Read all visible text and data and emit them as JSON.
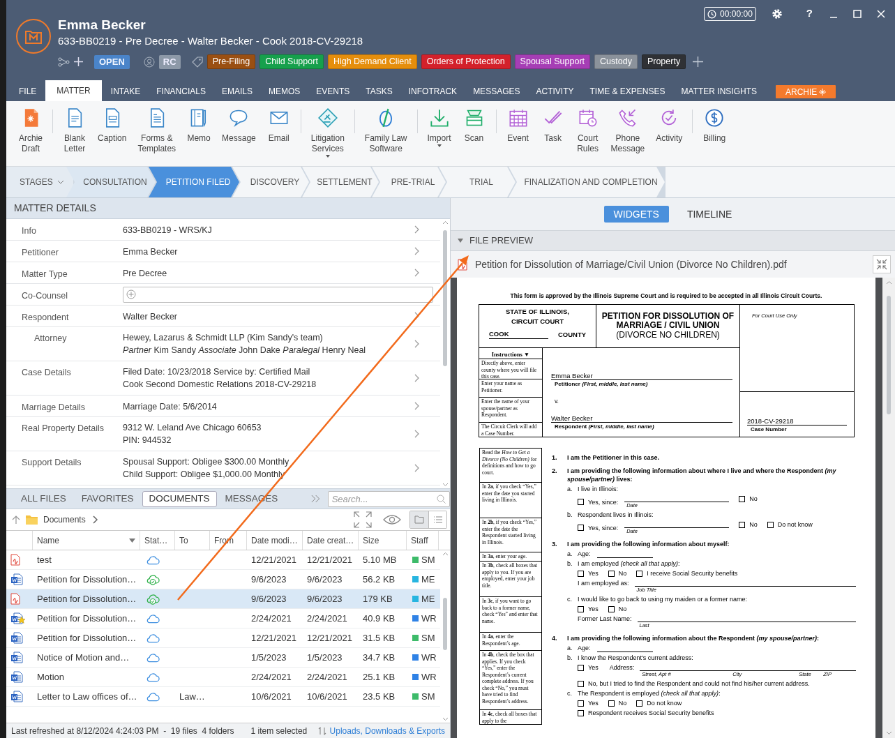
{
  "header": {
    "client_name": "Emma Becker",
    "matter_line": "633-BB0219 - Pre Decree - Walter Becker - Cook 2018-CV-29218",
    "status": "OPEN",
    "initials": "RC",
    "tags": [
      {
        "label": "Pre-Filing",
        "color": "#9a4f12"
      },
      {
        "label": "Child Support",
        "color": "#16a04c"
      },
      {
        "label": "High Demand Client",
        "color": "#e58e0c"
      },
      {
        "label": "Orders of Protection",
        "color": "#d3212b"
      },
      {
        "label": "Spousal Support",
        "color": "#a63eb5"
      },
      {
        "label": "Custody",
        "color": "#8b929b"
      },
      {
        "label": "Property",
        "color": "#2f3135"
      }
    ],
    "timer": "00:00:00",
    "help": "?"
  },
  "tabs": [
    {
      "label": "FILE",
      "selected": false
    },
    {
      "label": "MATTER",
      "selected": true
    },
    {
      "label": "INTAKE",
      "selected": false
    },
    {
      "label": "FINANCIALS",
      "selected": false
    },
    {
      "label": "EMAILS",
      "selected": false
    },
    {
      "label": "MEMOS",
      "selected": false
    },
    {
      "label": "EVENTS",
      "selected": false
    },
    {
      "label": "TASKS",
      "selected": false
    },
    {
      "label": "INFOTRACK",
      "selected": false
    },
    {
      "label": "MESSAGES",
      "selected": false
    },
    {
      "label": "ACTIVITY",
      "selected": false
    },
    {
      "label": "TIME & EXPENSES",
      "selected": false
    },
    {
      "label": "MATTER INSIGHTS",
      "selected": false
    }
  ],
  "archie_button": "ARCHIE",
  "ribbon": {
    "groups": [
      [
        {
          "label": "Archie\nDraft",
          "dropdown": false
        }
      ],
      [
        {
          "label": "Blank\nLetter",
          "dropdown": false
        },
        {
          "label": "Caption",
          "dropdown": false
        },
        {
          "label": "Forms &\nTemplates",
          "dropdown": false
        },
        {
          "label": "Memo",
          "dropdown": false
        },
        {
          "label": "Message",
          "dropdown": false
        },
        {
          "label": "Email",
          "dropdown": false
        }
      ],
      [
        {
          "label": "Litigation\nServices",
          "dropdown": true
        }
      ],
      [
        {
          "label": "Family Law\nSoftware",
          "dropdown": false
        }
      ],
      [
        {
          "label": "Import",
          "dropdown": true
        },
        {
          "label": "Scan",
          "dropdown": false
        }
      ],
      [
        {
          "label": "Event",
          "dropdown": false
        },
        {
          "label": "Task",
          "dropdown": false
        },
        {
          "label": "Court\nRules",
          "dropdown": false
        },
        {
          "label": "Phone\nMessage",
          "dropdown": false
        },
        {
          "label": "Activity",
          "dropdown": false
        }
      ],
      [
        {
          "label": "Billing",
          "dropdown": false
        }
      ]
    ]
  },
  "stages": {
    "label": "STAGES",
    "items": [
      {
        "label": "CONSULTATION",
        "selected": false,
        "completed": true
      },
      {
        "label": "PETITION FILED",
        "selected": true,
        "completed": false
      },
      {
        "label": "DISCOVERY",
        "selected": false,
        "completed": false
      },
      {
        "label": "SETTLEMENT",
        "selected": false,
        "completed": false
      },
      {
        "label": "PRE-TRIAL",
        "selected": false,
        "completed": false
      },
      {
        "label": "TRIAL",
        "selected": false,
        "completed": false
      },
      {
        "label": "FINALIZATION AND COMPLETION",
        "selected": false,
        "completed": false
      }
    ]
  },
  "matter_details": {
    "title": "MATTER DETAILS",
    "rows": [
      {
        "label": "Info",
        "kind": "text",
        "lines": [
          "633-BB0219 - WRS/KJ"
        ]
      },
      {
        "label": "Petitioner",
        "kind": "text",
        "lines": [
          "Emma Becker"
        ]
      },
      {
        "label": "Matter Type",
        "kind": "text",
        "lines": [
          "Pre Decree"
        ]
      },
      {
        "label": "Co-Counsel",
        "kind": "add_field"
      },
      {
        "label": "Respondent",
        "kind": "text",
        "lines": [
          "Walter Becker"
        ],
        "children": [
          {
            "label": "Attorney",
            "kind": "text",
            "lines": [
              "Hewey, Lazarus & Schmidt LLP (Kim Sandy's team)",
              "*Partner* Kim Sandy *Associate* John Dake *Paralegal* Henry Neal"
            ]
          }
        ]
      },
      {
        "label": "Case Details",
        "kind": "text",
        "lines": [
          "Filed Date: 10/23/2018 Service by: Certified Mail",
          "Cook Second Domestic Relations 2018-CV-29218"
        ]
      },
      {
        "label": "Marriage Details",
        "kind": "text",
        "lines": [
          "Marriage Date: 5/6/2014"
        ]
      },
      {
        "label": "Real Property Details",
        "kind": "text",
        "lines": [
          "9312 W. Leland Ave Chicago 60653",
          "PIN: 944532"
        ]
      },
      {
        "label": "Support Details",
        "kind": "text",
        "lines": [
          "Spousal Support: Obligee $300.00 Monthly",
          "Child Support: Obligee $1,000.00 Monthly"
        ]
      }
    ]
  },
  "files": {
    "tabs": [
      {
        "label": "ALL FILES",
        "selected": false
      },
      {
        "label": "FAVORITES",
        "selected": false
      },
      {
        "label": "DOCUMENTS",
        "selected": true
      },
      {
        "label": "MESSAGES",
        "selected": false
      }
    ],
    "search_placeholder": "Search...",
    "folder": "Documents",
    "view_modes": [
      {
        "kind": "folder",
        "selected": true
      },
      {
        "kind": "list",
        "selected": false
      }
    ],
    "columns": [
      {
        "label": "Name",
        "sorted": true
      },
      {
        "label": "Stat…"
      },
      {
        "label": "To"
      },
      {
        "label": "From"
      },
      {
        "label": "Date modi…"
      },
      {
        "label": "Date creat…"
      },
      {
        "label": "Size"
      },
      {
        "label": "Staff"
      }
    ],
    "rows": [
      {
        "kind": "pdf",
        "name": "test",
        "synced": false,
        "modified": "12/21/2021",
        "created": "12/21/2021",
        "size": "5.10 MB",
        "staff": {
          "initials": "SM",
          "color": "#3dbb6a"
        },
        "selected": false
      },
      {
        "kind": "word",
        "name": "Petition for Dissolution…",
        "synced": true,
        "modified": "9/6/2023",
        "created": "9/6/2023",
        "size": "56.2 KB",
        "staff": {
          "initials": "ME",
          "color": "#27b5e0"
        },
        "selected": false
      },
      {
        "kind": "pdf",
        "name": "Petition for Dissolution…",
        "synced": true,
        "modified": "9/6/2023",
        "created": "9/6/2023",
        "size": "179 KB",
        "staff": {
          "initials": "ME",
          "color": "#27b5e0"
        },
        "selected": true
      },
      {
        "kind": "word_star",
        "name": "Petition for Dissolution…",
        "synced": false,
        "modified": "2/24/2021",
        "created": "2/24/2021",
        "size": "40.9 KB",
        "staff": {
          "initials": "WR",
          "color": "#2f82e6"
        },
        "selected": false
      },
      {
        "kind": "word",
        "name": "Petition for Dissolution…",
        "synced": false,
        "modified": "12/21/2021",
        "created": "12/21/2021",
        "size": "31.5 KB",
        "staff": {
          "initials": "SM",
          "color": "#3dbb6a"
        },
        "selected": false
      },
      {
        "kind": "word",
        "name": "Notice of Motion and…",
        "synced": false,
        "modified": "1/5/2023",
        "created": "1/5/2023",
        "size": "34.7 KB",
        "staff": {
          "initials": "WR",
          "color": "#2f82e6"
        },
        "selected": false
      },
      {
        "kind": "word",
        "name": "Motion",
        "synced": false,
        "modified": "2/24/2021",
        "created": "2/24/2021",
        "size": "25.1 KB",
        "staff": {
          "initials": "WR",
          "color": "#2f82e6"
        },
        "selected": false
      },
      {
        "kind": "word",
        "name": "Letter to Law offices of…",
        "synced": false,
        "to": "Law…",
        "modified": "10/6/2021",
        "created": "10/6/2021",
        "size": "23.5 KB",
        "staff": {
          "initials": "SM",
          "color": "#3dbb6a"
        },
        "selected": false
      }
    ],
    "status_bar": {
      "refreshed": "Last refreshed at 8/12/2024 4:24:03 PM  -  19 files  4 folders",
      "selection": "1 item selected",
      "link": "Uploads, Downloads & Exports"
    }
  },
  "view_tabs": [
    {
      "label": "WIDGETS",
      "selected": true
    },
    {
      "label": "TIMELINE",
      "selected": false
    }
  ],
  "file_preview": {
    "title": "FILE PREVIEW",
    "expanded": true,
    "file_name": "Petition for Dissolution of Marriage/Civil Union (Divorce No Children).pdf",
    "document": {
      "notice": "This form is approved by the Illinois Supreme Court and is required to be accepted in all Illinois Circuit Courts.",
      "state_lines": "STATE OF ILLINOIS,\nCIRCUIT COURT",
      "county_value": "COOK",
      "county_label": "COUNTY",
      "title": "PETITION FOR DISSOLUTION OF\nMARRIAGE / CIVIL UNION",
      "subtitle": "(DIVORCE NO CHILDREN)",
      "court_use": "For Court Use Only",
      "instructions_heading": "Instructions ▼",
      "instructions": [
        "Directly above, enter county where you will file this case.",
        "Enter your name as Petitioner.",
        "Enter the name of your spouse/partner as Respondent.",
        "The Circuit Clerk will add a Case Number."
      ],
      "petitioner": "Emma Becker",
      "petitioner_label": "Petitioner *(First, middle, last name)*",
      "versus": "v.",
      "respondent": "Walter Becker",
      "respondent_label": "Respondent *(First, middle, last name)*",
      "case_number": "2018-CV-29218",
      "case_number_label": "Case Number",
      "notes": [
        "Read the *How to Get a Divorce (No Children)* for definitions and how to go court.",
        "In **2a**, if you check “Yes,” enter the date you started living in Illinois.",
        "In **2b**, if you check “Yes,” enter the date the Respondent started living in Illinois.",
        "In **3a**, enter your age.",
        "In **3b**, check all boxes that apply to you. If you are employed, enter your job title.",
        "In **3c**, if you want to go back to a former name, check “Yes” and enter that name.",
        "In **4a**, enter the Respondent’s age.",
        "In **4b**, check the box that applies. If you check “Yes,” enter the Respondent’s current complete address. If you check “No,” you must have tried to find Respondent’s address.",
        "In **4c**, check all boxes that apply to the"
      ],
      "items": [
        {
          "kind": "heading",
          "number": "1.",
          "text": "I am the Petitioner in this case."
        },
        {
          "kind": "heading",
          "number": "2.",
          "text": "I am providing the following information about where I live and where the Respondent *(my spouse/partner)* lives:"
        },
        {
          "kind": "sub",
          "letter": "a.",
          "text": "I live in Illinois:"
        },
        {
          "kind": "checks",
          "options": [
            {
              "label": "Yes, since:",
              "checked": false,
              "caption": "Date"
            },
            {
              "label": "No",
              "checked": false
            }
          ]
        },
        {
          "kind": "sub",
          "letter": "b.",
          "text": "Respondent lives in Illinois:"
        },
        {
          "kind": "checks",
          "options": [
            {
              "label": "Yes, since:",
              "checked": false,
              "caption": "Date"
            },
            {
              "label": "No",
              "checked": false
            },
            {
              "label": "Do not know",
              "checked": false
            }
          ]
        },
        {
          "kind": "heading",
          "number": "3.",
          "text": "I am providing the following information about myself:"
        },
        {
          "kind": "sub_blank",
          "letter": "a.",
          "text": "Age:"
        },
        {
          "kind": "sub",
          "letter": "b.",
          "text": "I am employed *(check all that apply)*:"
        },
        {
          "kind": "checks",
          "options": [
            {
              "label": "Yes",
              "checked": false
            },
            {
              "label": "No",
              "checked": false
            },
            {
              "label": "I receive Social Security benefits",
              "checked": false
            }
          ]
        },
        {
          "kind": "field",
          "label": "I am employed as:",
          "captions": [
            "Job Title"
          ]
        },
        {
          "kind": "sub",
          "letter": "c.",
          "text": "I would like to go back to using my maiden or a former name:"
        },
        {
          "kind": "checks",
          "options": [
            {
              "label": "Yes",
              "checked": false
            },
            {
              "label": "No",
              "checked": false
            }
          ]
        },
        {
          "kind": "field",
          "label": "Former Last Name:",
          "captions": [
            "Last"
          ]
        },
        {
          "kind": "heading",
          "number": "4.",
          "text": "I am providing the following information about the Respondent *(my spouse/partner)*:"
        },
        {
          "kind": "sub_blank",
          "letter": "a.",
          "text": "Age:"
        },
        {
          "kind": "sub",
          "letter": "b.",
          "text": "I know the Respondent's current address:"
        },
        {
          "kind": "check_field",
          "option": {
            "label": "Yes",
            "checked": false
          },
          "label": "Address:",
          "captions": [
            "Street, Apt #",
            "City",
            "State",
            "ZIP"
          ]
        },
        {
          "kind": "checks",
          "options": [
            {
              "label": "No, but I tried to find the Respondent and could not find his/her current address.",
              "checked": false
            }
          ]
        },
        {
          "kind": "sub",
          "letter": "c.",
          "text": "The Respondent is employed *(check all that apply)*:"
        },
        {
          "kind": "checks",
          "options": [
            {
              "label": "Yes",
              "checked": false
            },
            {
              "label": "No",
              "checked": false
            },
            {
              "label": "Do not know",
              "checked": false
            }
          ]
        },
        {
          "kind": "checks",
          "options": [
            {
              "label": "Respondent receives Social Security benefits",
              "checked": false
            }
          ]
        }
      ]
    }
  }
}
